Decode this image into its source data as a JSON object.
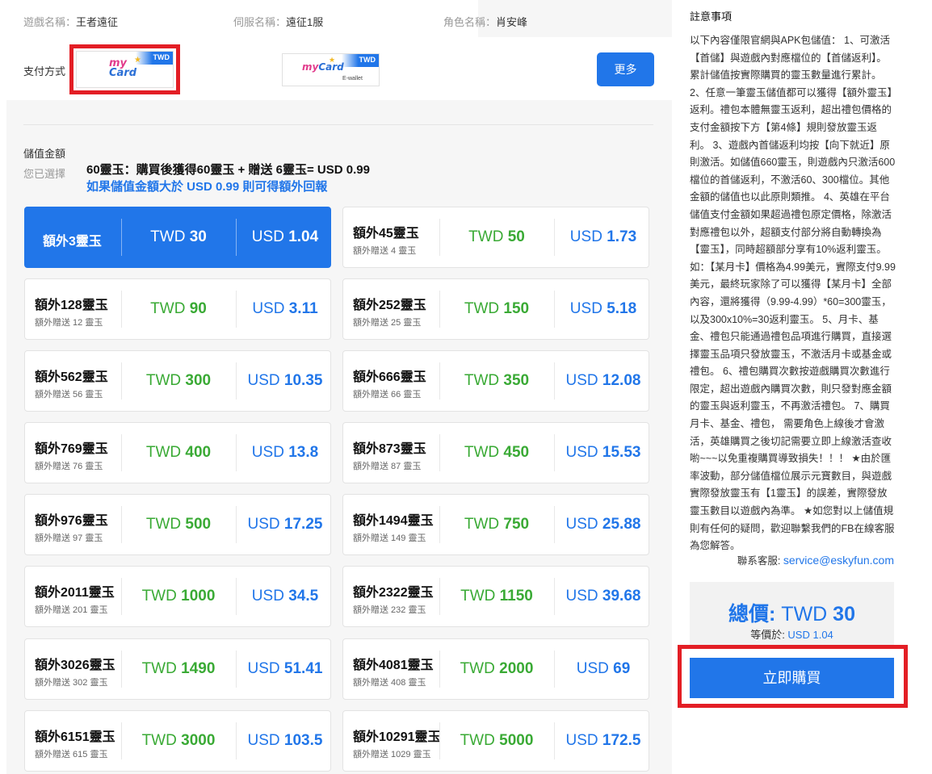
{
  "game_info": {
    "game_label": "遊戲名稱：",
    "game_value": "王者遠征",
    "server_label": "伺服名稱：",
    "server_value": "遠征1服",
    "role_label": "角色名稱：",
    "role_value": "肖安峰"
  },
  "payment": {
    "label": "支付方式",
    "methods": [
      {
        "logo_text": "MyCard",
        "badge": "TWD",
        "sub": "",
        "selected": true
      },
      {
        "logo_text": "MyCard",
        "badge": "TWD",
        "sub": "E-wallet",
        "selected": false
      }
    ],
    "more_label": "更多"
  },
  "amount": {
    "title": "儲值金額",
    "subtitle": "您已選擇",
    "selection_text": "60靈玉：購買後獲得60靈玉 + 贈送 6靈玉= USD 0.99",
    "hint_text": "如果儲值金額大於 USD 0.99 則可得額外回報"
  },
  "options": [
    {
      "name": "額外3靈玉",
      "bonus": "",
      "twd_prefix": "TWD ",
      "twd": "30",
      "usd_prefix": "USD ",
      "usd": "1.04",
      "active": true
    },
    {
      "name": "額外45靈玉",
      "bonus": "額外贈送 4 靈玉",
      "twd_prefix": "TWD ",
      "twd": "50",
      "usd_prefix": "USD ",
      "usd": "1.73"
    },
    {
      "name": "額外128靈玉",
      "bonus": "額外贈送 12 靈玉",
      "twd_prefix": "TWD ",
      "twd": "90",
      "usd_prefix": "USD ",
      "usd": "3.11"
    },
    {
      "name": "額外252靈玉",
      "bonus": "額外贈送 25 靈玉",
      "twd_prefix": "TWD ",
      "twd": "150",
      "usd_prefix": "USD ",
      "usd": "5.18"
    },
    {
      "name": "額外562靈玉",
      "bonus": "額外贈送 56 靈玉",
      "twd_prefix": "TWD ",
      "twd": "300",
      "usd_prefix": "USD ",
      "usd": "10.35"
    },
    {
      "name": "額外666靈玉",
      "bonus": "額外贈送 66 靈玉",
      "twd_prefix": "TWD ",
      "twd": "350",
      "usd_prefix": "USD ",
      "usd": "12.08"
    },
    {
      "name": "額外769靈玉",
      "bonus": "額外贈送 76 靈玉",
      "twd_prefix": "TWD ",
      "twd": "400",
      "usd_prefix": "USD ",
      "usd": "13.8"
    },
    {
      "name": "額外873靈玉",
      "bonus": "額外贈送 87 靈玉",
      "twd_prefix": "TWD ",
      "twd": "450",
      "usd_prefix": "USD ",
      "usd": "15.53"
    },
    {
      "name": "額外976靈玉",
      "bonus": "額外贈送 97 靈玉",
      "twd_prefix": "TWD ",
      "twd": "500",
      "usd_prefix": "USD ",
      "usd": "17.25"
    },
    {
      "name": "額外1494靈玉",
      "bonus": "額外贈送 149 靈玉",
      "twd_prefix": "TWD ",
      "twd": "750",
      "usd_prefix": "USD ",
      "usd": "25.88"
    },
    {
      "name": "額外2011靈玉",
      "bonus": "額外贈送 201 靈玉",
      "twd_prefix": "TWD ",
      "twd": "1000",
      "usd_prefix": "USD ",
      "usd": "34.5"
    },
    {
      "name": "額外2322靈玉",
      "bonus": "額外贈送 232 靈玉",
      "twd_prefix": "TWD ",
      "twd": "1150",
      "usd_prefix": "USD ",
      "usd": "39.68"
    },
    {
      "name": "額外3026靈玉",
      "bonus": "額外贈送 302 靈玉",
      "twd_prefix": "TWD ",
      "twd": "1490",
      "usd_prefix": "USD ",
      "usd": "51.41"
    },
    {
      "name": "額外4081靈玉",
      "bonus": "額外贈送 408 靈玉",
      "twd_prefix": "TWD ",
      "twd": "2000",
      "usd_prefix": "USD ",
      "usd": "69"
    },
    {
      "name": "額外6151靈玉",
      "bonus": "額外贈送 615 靈玉",
      "twd_prefix": "TWD ",
      "twd": "3000",
      "usd_prefix": "USD ",
      "usd": "103.5"
    },
    {
      "name": "額外10291靈玉",
      "bonus": "額外贈送 1029 靈玉",
      "twd_prefix": "TWD ",
      "twd": "5000",
      "usd_prefix": "USD ",
      "usd": "172.5"
    }
  ],
  "notice": {
    "title": "註意事項",
    "text": "以下內容僅限官網與APK包儲值： 1、可激活【首儲】與遊戲內對應檔位的【首儲返利】。累計儲值按實際購買的靈玉數量進行累計。 2、任意一筆靈玉儲值都可以獲得【額外靈玉】返利。禮包本體無靈玉返利，超出禮包價格的支付金額按下方【第4條】規則發放靈玉返利。 3、遊戲內首儲返利均按【向下就近】原則激活。如儲值660靈玉，則遊戲內只激活600檔位的首儲返利，不激活60、300檔位。其他金額的儲值也以此原則類推。 4、英雄在平台儲值支付金額如果超過禮包原定價格，除激活對應禮包以外，超額支付部分將自動轉換為【靈玉】，同時超額部分享有10%返利靈玉。如：【某月卡】價格為4.99美元，實際支付9.99美元，最終玩家除了可以獲得【某月卡】全部內容，還將獲得（9.99-4.99）*60=300靈玉，以及300x10%=30返利靈玉。 5、月卡、基金、禮包只能通過禮包品項進行購買，直接選擇靈玉品項只發放靈玉，不激活月卡或基金或禮包。 6、禮包購買次數按遊戲購買次數進行限定，超出遊戲內購買次數，則只發對應金額的靈玉與返利靈玉，不再激活禮包。 7、購買月卡、基金、禮包， 需要角色上線後才會激活，英雄購買之後切記需要立即上線激活查收喲~~~以免重複購買導致損失！！！ ★由於匯率波動，部分儲值檔位展示元寶數目，與遊戲實際發放靈玉有【1靈玉】的誤差，實際發放靈玉數目以遊戲內為準。 ★如您對以上儲值規則有任何的疑問，歡迎聯繫我們的FB在線客服為您解答。",
    "contact_label": "聯系客服: ",
    "contact_email": "service@eskyfun.com"
  },
  "summary": {
    "total_label": "總價: ",
    "total_currency": "TWD ",
    "total_value": "30",
    "equiv_label": "等價於: ",
    "equiv_value": "USD 1.04",
    "buy_label": "立即購買"
  },
  "colors": {
    "accent": "#2176e9",
    "twd_green": "#3aaa35",
    "highlight_red": "#e31e25"
  }
}
